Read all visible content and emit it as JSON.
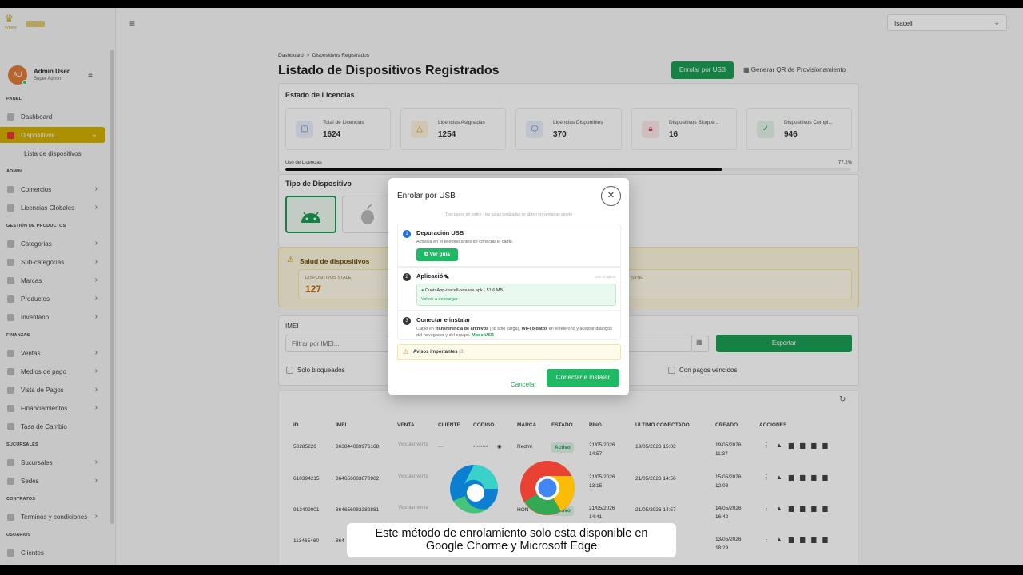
{
  "brand": {
    "logo_text": "Where"
  },
  "header": {
    "store_select": "Isacell"
  },
  "user": {
    "initials": "AU",
    "name": "Admin User",
    "role": "Super Admin"
  },
  "sidebar": {
    "sections": {
      "panel": "PANEL",
      "admin": "ADMIN",
      "gestion": "GESTIÓN DE PRODUCTOS",
      "finanzas": "FINANZAS",
      "sucursales": "SUCURSALES",
      "contratos": "CONTRATOS",
      "usuarios": "USUARIOS"
    },
    "items": {
      "dashboard": "Dashboard",
      "dispositivos": "Dispositivos",
      "lista": "Lista de dispositivos",
      "comercios": "Comercios",
      "licencias": "Licencias Globales",
      "categorias": "Categorias",
      "subcategorias": "Sub-categorías",
      "marcas": "Marcas",
      "productos": "Productos",
      "inventario": "Inventario",
      "ventas": "Ventas",
      "medios": "Medios de pago",
      "vista": "Vista de Pagos",
      "financiamientos": "Financiamientos",
      "tasa": "Tasa de Cambio",
      "sucursales": "Sucursales",
      "sedes": "Sedes",
      "terminos": "Terminos y condiciones",
      "clientes": "Clientes"
    }
  },
  "breadcrumb": {
    "home": "Dashboard",
    "sep": ">",
    "current": "Dispositivos Registrados"
  },
  "page": {
    "title": "Listado de Dispositivos Registrados",
    "enroll_btn": "Enrolar por USB",
    "qr_btn": "Generar QR de Provisionamiento"
  },
  "licencias": {
    "title": "Estado de Licencias",
    "stats": [
      {
        "label": "Total de Licencias",
        "value": "1624"
      },
      {
        "label": "Licencias Asignadas",
        "value": "1254"
      },
      {
        "label": "Licencias Disponibles",
        "value": "370"
      },
      {
        "label": "Dispositivos Bloque...",
        "value": "16"
      },
      {
        "label": "Dispositivos Compl...",
        "value": "946"
      }
    ],
    "usage_label": "Uso de Licencias",
    "usage_pct": "77.2%",
    "usage_fraction": 0.772
  },
  "tipo": {
    "title": "Tipo de Dispositivo"
  },
  "salud": {
    "title": "Salud de dispositivos",
    "stale_label": "DISPOSITIVOS STALE",
    "stale_value": "127",
    "sync_label": "SYNC"
  },
  "filters": {
    "imei_label": "IMEI",
    "imei_placeholder": "Filtrar por IMEI...",
    "export": "Exportar",
    "solo_bloqueados": "Solo bloqueados",
    "pagos_vencidos": "Con pagos vencidos"
  },
  "table": {
    "headers": [
      "ID",
      "IMEI",
      "VENTA",
      "CLIENTE",
      "CÓDIGO",
      "MARCA",
      "ESTADO",
      "PING",
      "ÚLTIMO CONECTADO",
      "CREADO",
      "ACCIONES"
    ],
    "rows": [
      {
        "id": "50285226",
        "imei": "863844089976168",
        "venta": "Vincular venta",
        "cliente": "—",
        "codigo": "••••••••",
        "marca": "Redmi",
        "estado": "Activo",
        "ping": "21/05/2026 14:57",
        "ultimo": "19/05/2026 15:03",
        "creado": "19/05/2026 11:37"
      },
      {
        "id": "610394215",
        "imei": "864656083670962",
        "venta": "Vincular venta",
        "cliente": "",
        "codigo": "",
        "marca": "",
        "estado": "",
        "ping": "21/05/2026 13:15",
        "ultimo": "21/05/2026 14:50",
        "creado": "15/05/2026 12:03"
      },
      {
        "id": "913409001",
        "imei": "864656083382881",
        "venta": "Vincular venta",
        "cliente": "",
        "codigo": "",
        "marca": "HON",
        "estado": "Activo",
        "ping": "21/05/2026 14:41",
        "ultimo": "21/05/2026 14:57",
        "creado": "14/05/2026 16:42"
      },
      {
        "id": "113465460",
        "imei": "864",
        "venta": "",
        "cliente": "",
        "codigo": "",
        "marca": "",
        "estado": "",
        "ping": "",
        "ultimo": "",
        "creado": "13/05/2026 18:29"
      }
    ]
  },
  "modal": {
    "title": "Enrolar por USB",
    "subtitle": "Tres pasos en orden · las guías detalladas se abren en ventanas aparte",
    "step1": {
      "num": "1",
      "title": "Depuración USB",
      "desc": "Actívala en el teléfono antes de conectar el cable.",
      "btn": "Ver guía"
    },
    "step2": {
      "num": "2",
      "title": "Aplicación",
      "optional": "solo si aplica",
      "file": "CuotaApp-isacell-release.apk · 51.6 MB",
      "redownload": "Volver a descargar"
    },
    "step3": {
      "num": "3",
      "title": "Conectar e instalar",
      "desc_a": "Cable en ",
      "desc_b": "transferencia de archivos",
      "desc_c": " (no solo carga), ",
      "desc_d": "WiFi o datos",
      "desc_e": " en el teléfono y aceptar diálogos del navegador y del equipo. ",
      "desc_f": "Modo USB"
    },
    "avisos": "Avisos importantes",
    "avisos_count": "(3)",
    "cancel": "Cancelar",
    "confirm": "Conectar e instalar"
  },
  "caption": {
    "line1": "Este método de enrolamiento  solo esta disponible en",
    "line2": "Google Chorme y Microsoft Edge"
  },
  "colors": {
    "green": "#1b9e53",
    "gold": "#d4b000",
    "warn": "#fdf7dd"
  }
}
